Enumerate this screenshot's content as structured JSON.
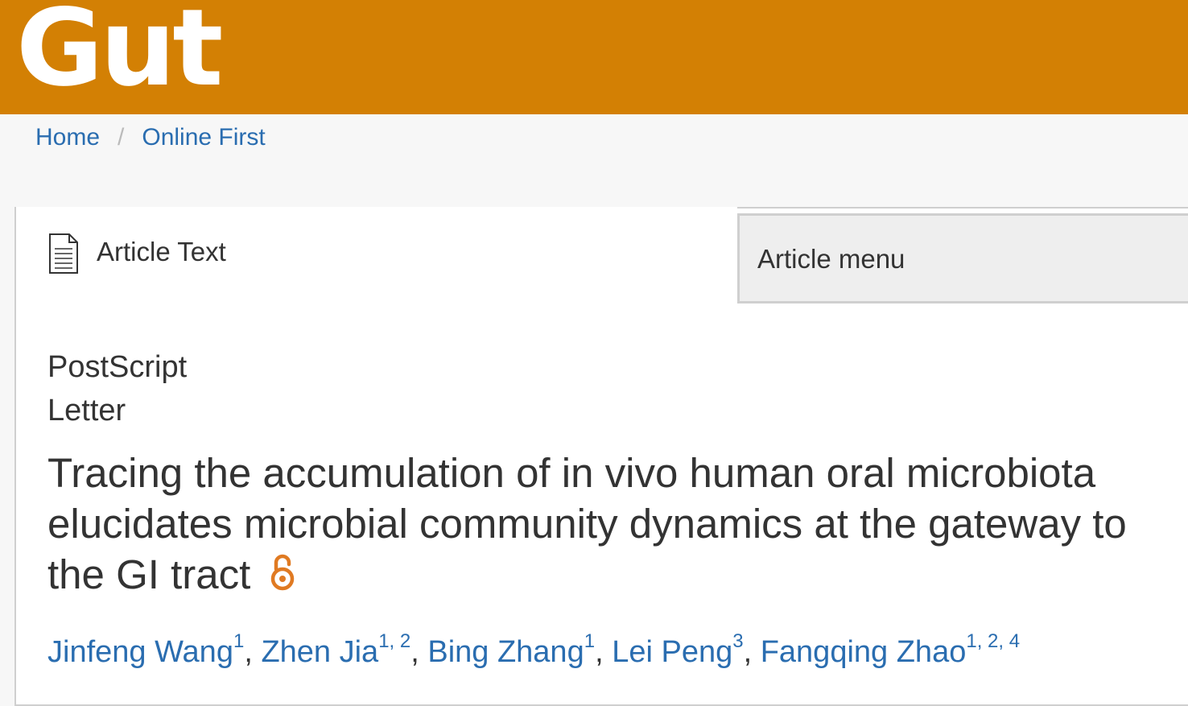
{
  "header": {
    "logo": "Gut",
    "brand_color": "#d38004"
  },
  "breadcrumb": {
    "items": [
      {
        "label": "Home"
      },
      {
        "label": "Online First"
      }
    ],
    "separator": "/"
  },
  "tabs": {
    "article_text": {
      "label": "Article Text",
      "icon": "document-icon"
    },
    "article_menu": {
      "label": "Article menu"
    }
  },
  "article": {
    "types": [
      "PostScript",
      "Letter"
    ],
    "title": "Tracing the accumulation of in vivo human oral microbiota elucidates microbial community dynamics at the gateway to the GI tract",
    "open_access_icon": "open-access-icon",
    "authors": [
      {
        "name": "Jinfeng Wang",
        "affiliations": "1"
      },
      {
        "name": "Zhen Jia",
        "affiliations": "1, 2"
      },
      {
        "name": "Bing Zhang",
        "affiliations": "1"
      },
      {
        "name": "Lei Peng",
        "affiliations": "3"
      },
      {
        "name": "Fangqing Zhao",
        "affiliations": "1, 2, 4"
      }
    ]
  },
  "colors": {
    "link": "#2a6db0",
    "open_access": "#e07a22"
  }
}
